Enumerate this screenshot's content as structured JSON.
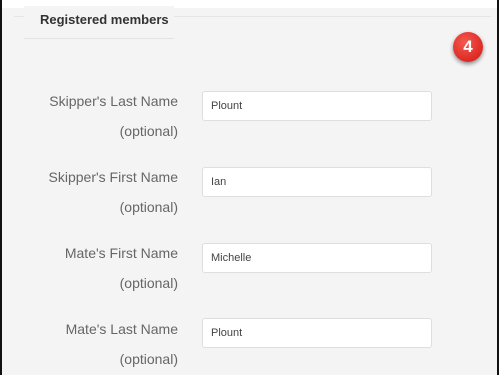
{
  "fieldset": {
    "legend": "Registered members"
  },
  "badge": {
    "number": "4",
    "color": "#e0302a"
  },
  "fields": [
    {
      "label": "Skipper's Last Name",
      "hint": "(optional)",
      "value": "Plount"
    },
    {
      "label": "Skipper's First Name",
      "hint": "(optional)",
      "value": "Ian"
    },
    {
      "label": "Mate's First Name",
      "hint": "(optional)",
      "value": "Michelle"
    },
    {
      "label": "Mate's Last Name",
      "hint": "(optional)",
      "value": "Plount"
    }
  ]
}
